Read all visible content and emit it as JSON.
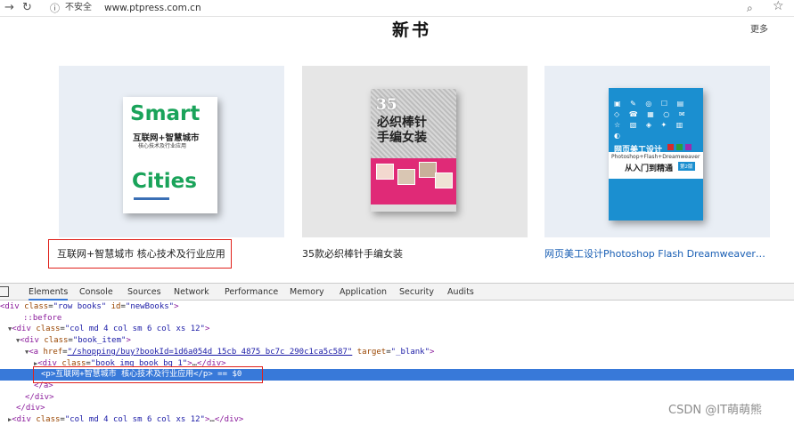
{
  "browser": {
    "security_label": "不安全",
    "url": "www.ptpress.com.cn"
  },
  "page": {
    "section_title": "新书",
    "more_link": "更多",
    "books": [
      {
        "caption": "互联网+智慧城市 核心技术及行业应用",
        "caption_color": "#222222",
        "cover": {
          "word1": "Smart",
          "title_cn": "互联网+智慧城市",
          "subtitle_cn": "核心技术及行业应用",
          "word2": "Cities"
        }
      },
      {
        "caption": "35款必织棒针手编女装",
        "caption_color": "#222222",
        "cover": {
          "number": "35",
          "title_cn": "必织棒针\n手编女装"
        }
      },
      {
        "caption": "网页美工设计Photoshop Flash Dreamweaver…",
        "caption_color": "#1a5fb4",
        "cover": {
          "title_cn": "网页美工设计",
          "subtitle_en": "Photoshop+Flash+Dreamweaver",
          "series": "从入门到精通",
          "edition": "第2版"
        }
      }
    ]
  },
  "devtools": {
    "tabs": [
      "Elements",
      "Console",
      "Sources",
      "Network",
      "Performance",
      "Memory",
      "Application",
      "Security",
      "Audits"
    ],
    "active_tab": "Elements"
  },
  "colors": {
    "highlight_red": "#e0201a",
    "selection_blue": "#3879d9",
    "smart_green": "#1aa35a",
    "knit_pink": "#e02a77",
    "web_blue": "#1b8fd0"
  },
  "watermark": "CSDN @IT萌萌熊"
}
